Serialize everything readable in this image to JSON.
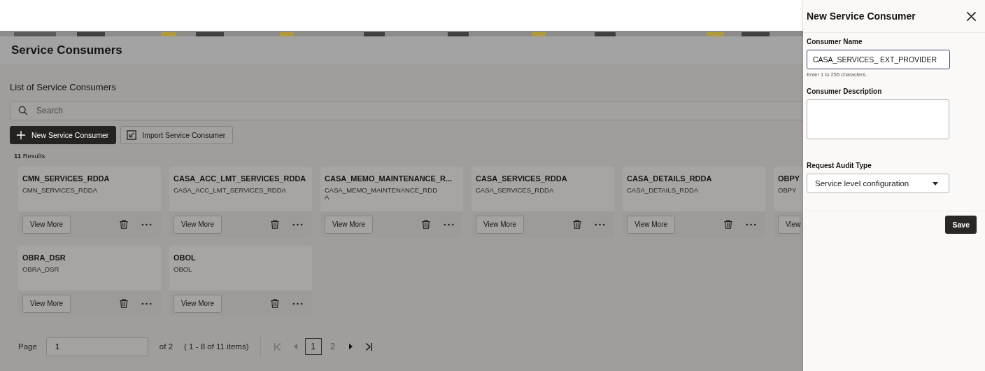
{
  "page_title": "Service Consumers",
  "section_title": "List of Service Consumers",
  "search": {
    "placeholder": "Search"
  },
  "actions": [
    {
      "label": "New Service Consumer",
      "kind": "primary"
    },
    {
      "label": "Import Service Consumer",
      "kind": "import"
    }
  ],
  "result_count": "**11** Results",
  "cards": [
    {
      "title": "CMN_SERVICES_RDDA",
      "description": "CMN_SERVICES_RDDA",
      "button": "View More"
    },
    {
      "title": "CASA_ACC_LMT_SERVICES_RDDA",
      "description": "CASA_ACC_LMT_SERVICES_RDDA",
      "button": "View More"
    },
    {
      "title": "CASA_MEMO_MAINTENANCE_R...",
      "description": "CASA_MEMO_MAINTENANCE_RDDA",
      "button": "View More"
    },
    {
      "title": "CASA_SERVICES_RDDA",
      "description": "CASA_SERVICES_RDDA",
      "button": "View More"
    },
    {
      "title": "CASA_DETAILS_RDDA",
      "description": "CASA_DETAILS_RDDA",
      "button": "View More"
    },
    {
      "title": "OBPY",
      "description": "OBPY",
      "button": "View",
      "kind": "cut"
    },
    {
      "title": "OBRA_DSR",
      "description": "OBRA_DSR",
      "button": "View More"
    },
    {
      "title": "OBOL",
      "description": "OBOL",
      "button": "View More"
    }
  ],
  "pagination": {
    "label": "Page",
    "value": "1",
    "total": "of 2",
    "range": "( 1 - 8 of 11 items)",
    "first": {
      "disabled": true
    },
    "previous": {
      "disabled": true
    },
    "pages": [
      {
        "label": "1",
        "selected": true
      },
      {
        "label": "2",
        "selected": false
      }
    ],
    "next": {
      "disabled": false
    },
    "last": {
      "disabled": false
    }
  },
  "drawer": {
    "title": "New Service Consumer",
    "fields": [
      {
        "kind": "text",
        "label": "Consumer Name",
        "value": "CASA_SERVICES_ EXT_PROVIDER",
        "hint": "Enter 1 to 255 characters."
      },
      {
        "kind": "textarea",
        "label": "Consumer Description"
      },
      {
        "kind": "select",
        "label": "Request Audit Type",
        "value": "Service level configuration"
      }
    ],
    "save": "Save"
  }
}
